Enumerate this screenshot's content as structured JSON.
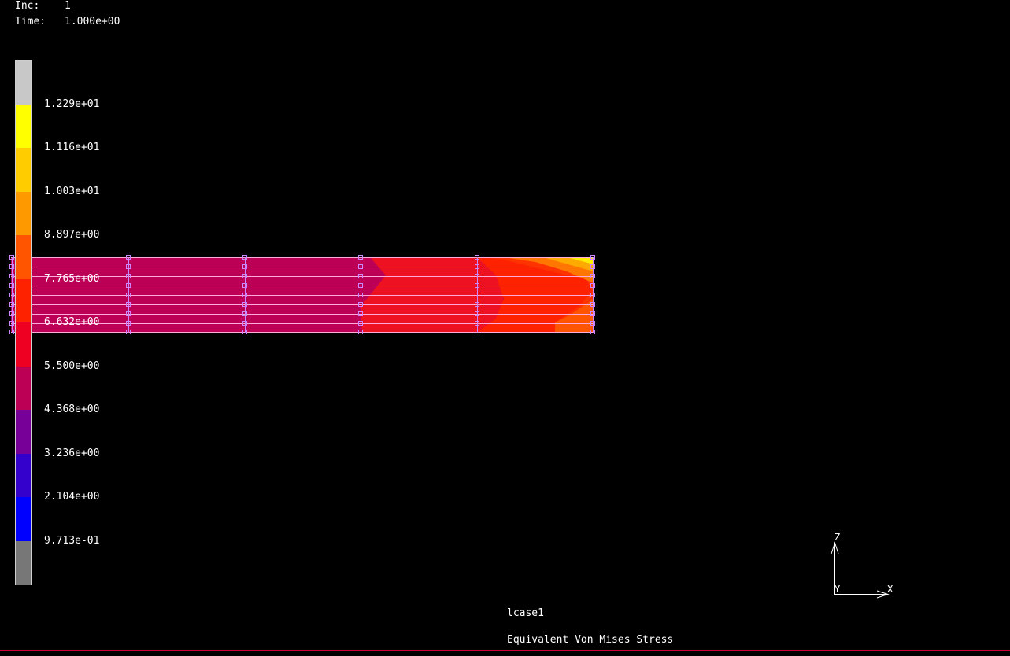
{
  "header": {
    "inc_label": "Inc:",
    "inc_value": "1",
    "time_label": "Time:",
    "time_value": "1.000e+00"
  },
  "legend": {
    "colors": [
      "#c8c8c8",
      "#ffff00",
      "#ffcc00",
      "#ff9900",
      "#ff5500",
      "#ff2200",
      "#ee0022",
      "#bb0055",
      "#770099",
      "#3300cc",
      "#0000ff",
      "#777777"
    ],
    "labels": [
      "1.229e+01",
      "1.116e+01",
      "1.003e+01",
      "8.897e+00",
      "7.765e+00",
      "6.632e+00",
      "5.500e+00",
      "4.368e+00",
      "3.236e+00",
      "2.104e+00",
      "9.713e-01"
    ]
  },
  "axes": {
    "z_label": "Z",
    "y_label": "Y",
    "x_label": "X"
  },
  "footer": {
    "load_case": "lcase1",
    "result_name": "Equivalent Von Mises Stress"
  },
  "mesh": {
    "base_color": "#bb0055",
    "line_color": "#ff99cc",
    "node_color": "#cc88ff"
  }
}
